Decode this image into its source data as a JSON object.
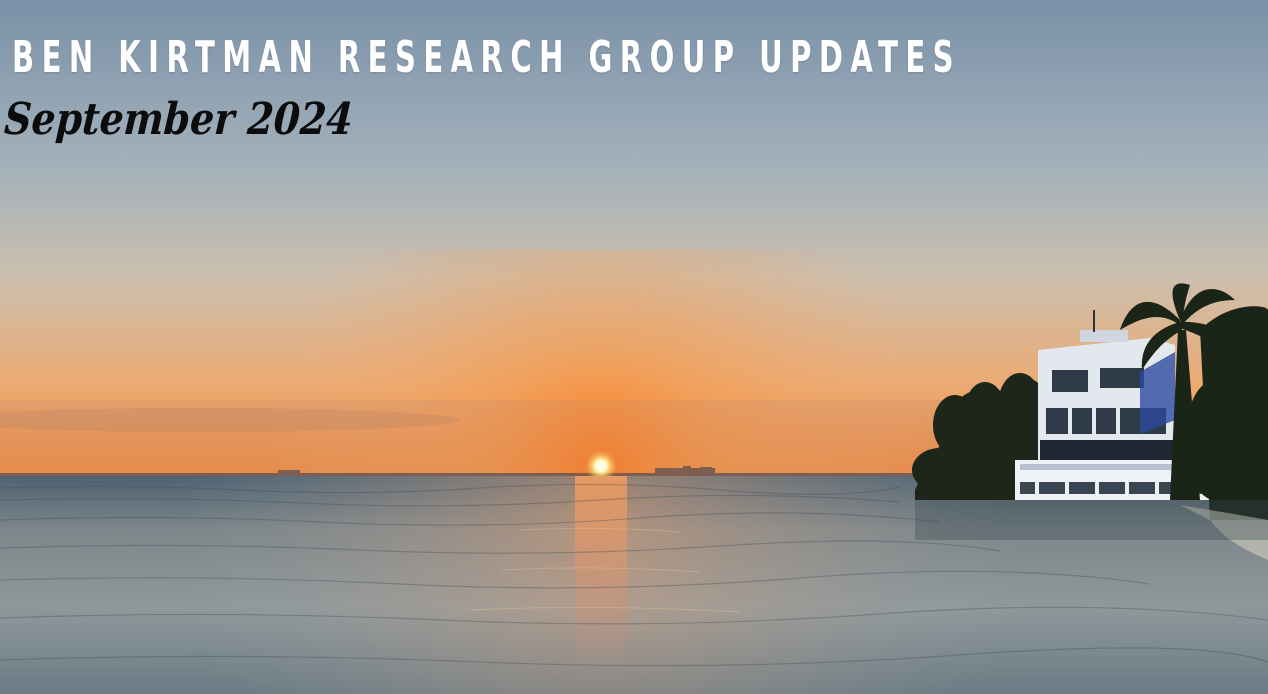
{
  "banner": {
    "headline": "BEN KIRTMAN RESEARCH GROUP UPDATES",
    "subtitle": "September 2024"
  },
  "photo": {
    "subject": "sunset-over-bay",
    "colors": {
      "sky_top": "#7f95ab",
      "sky_mid": "#b8bfc0",
      "sky_low": "#e8ad7a",
      "horizon_glow": "#f07a2e",
      "sun": "#fff3b0",
      "water_deep": "#455a69",
      "water_light": "#9fa9ad",
      "reflection": "#e88a50",
      "silhouette": "#1f2a1c",
      "building": "#e7ecf2"
    }
  }
}
